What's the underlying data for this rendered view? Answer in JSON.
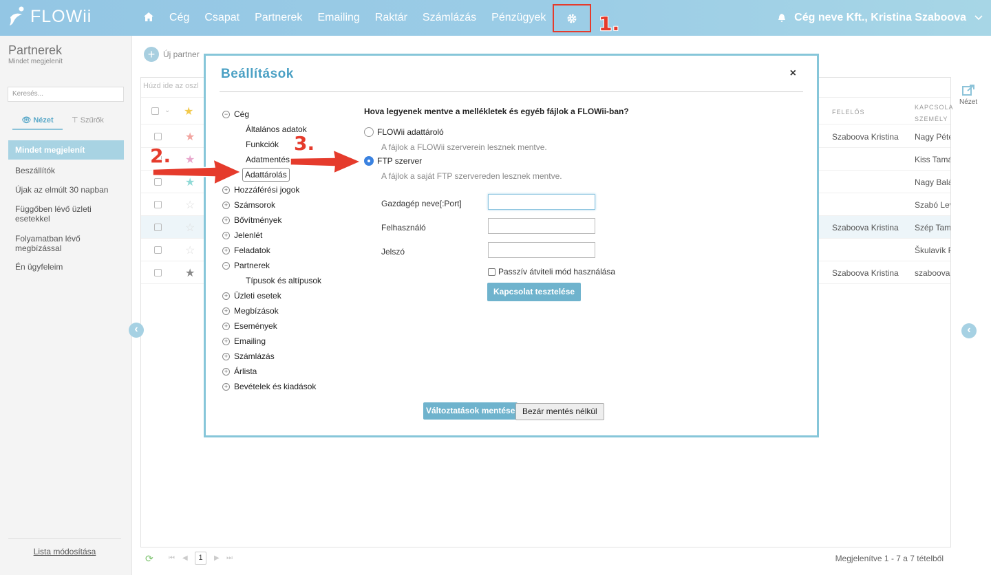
{
  "app": {
    "logo": "FLOWii",
    "nav": [
      "Cég",
      "Csapat",
      "Partnerek",
      "Emailing",
      "Raktár",
      "Számlázás",
      "Pénzügyek"
    ],
    "user": "Cég neve Kft., Kristina Szaboova"
  },
  "annotations": {
    "step1": "1.",
    "step2": "2.",
    "step3": "3."
  },
  "sidebar": {
    "title": "Partnerek",
    "subtitle": "Mindet megjelenít",
    "search_placeholder": "Keresés...",
    "tab_view": "Nézet",
    "tab_filter": "Szűrők",
    "selected": "Mindet megjelenít",
    "items": [
      "Beszállítók",
      "Újak az elmúlt 30 napban",
      "Függőben lévő üzleti esetekkel",
      "Folyamatban lévő megbízással",
      "Én ügyfeleim"
    ],
    "bottom_link": "Lista módosítása"
  },
  "toolbar": {
    "new_partner": "Új partner"
  },
  "grid": {
    "drop_hint": "Húzd ide az oszl",
    "col_owner": "FELELŐS",
    "col_contact": "KAPCSOLA SZEMÉLY",
    "rows": [
      {
        "star": "#f2a5a0",
        "owner": "Szaboova Kristina",
        "contact": "Nagy Péte"
      },
      {
        "star": "#e8a6cc",
        "owner": "",
        "contact": "Kiss Tamá"
      },
      {
        "star": "#8fd9d6",
        "owner": "",
        "contact": "Nagy Balá"
      },
      {
        "star": "#dddddd",
        "owner": "",
        "contact": "Szabó Lev"
      },
      {
        "star": "#dddddd",
        "owner": "Szaboova Kristina",
        "contact": "Szép Tam"
      },
      {
        "star": "#dddddd",
        "owner": "",
        "contact": "Škulavík P"
      },
      {
        "star": "#888888",
        "owner": "Szaboova Kristina",
        "contact": "szaboova"
      }
    ],
    "page": "1",
    "footer": "Megjelenítve 1 - 7 a 7 tételből"
  },
  "view_label": "Nézet",
  "dialog": {
    "title": "Beállítások",
    "close": "×",
    "tree": {
      "ceg": "Cég",
      "ceg_children": [
        "Általános adatok",
        "Funkciók",
        "Adatmentés",
        "Adattárolás"
      ],
      "groups_a": [
        "Hozzáférési jogok",
        "Számsorok",
        "Bővítmények",
        "Jelenlét",
        "Feladatok"
      ],
      "partnerek": "Partnerek",
      "partnerek_children": [
        "Típusok és altípusok"
      ],
      "groups_b": [
        "Üzleti esetek",
        "Megbízások",
        "Események",
        "Emailing",
        "Számlázás",
        "Árlista",
        "Bevételek és kiadások"
      ]
    },
    "question": "Hova legyenek mentve a mellékletek és egyéb fájlok a FLOWii-ban?",
    "opt1_label": "FLOWii adattároló",
    "opt1_desc": "A fájlok a FLOWii szerverein lesznek mentve.",
    "opt2_label": "FTP szerver",
    "opt2_desc": "A fájlok a saját FTP szervereden lesznek mentve.",
    "host_label": "Gazdagép neve[:Port]",
    "host_value": "",
    "user_label": "Felhasználó",
    "user_value": "",
    "pass_label": "Jelszó",
    "pass_value": "",
    "passive_label": "Passzív átviteli mód használása",
    "test_button": "Kapcsolat tesztelése",
    "save_button": "Változtatások mentése",
    "cancel_button": "Bezár mentés nélkül"
  }
}
